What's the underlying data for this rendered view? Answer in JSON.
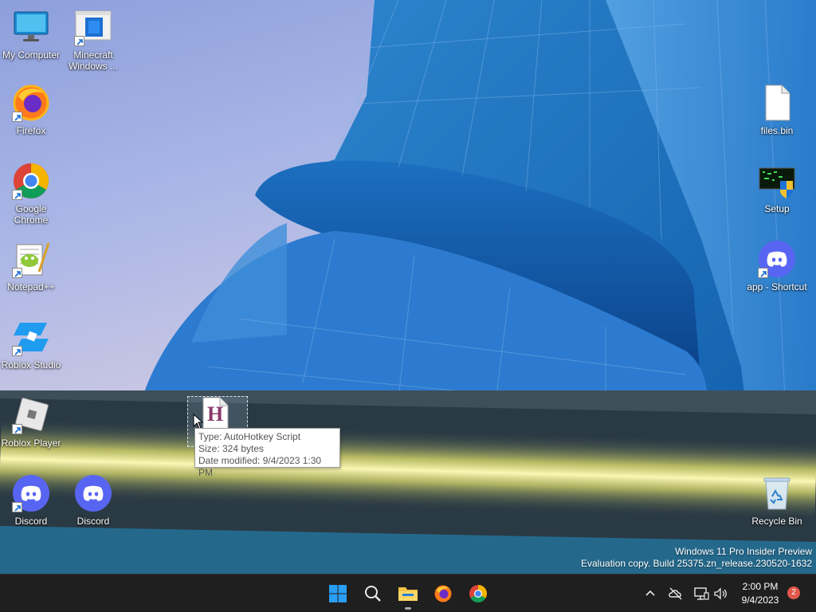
{
  "desktop": {
    "icons_left": [
      {
        "label": "My Computer",
        "icon": "monitor-icon",
        "shortcut": false
      },
      {
        "label": "Minecraft Windows ...",
        "icon": "minecraft-launcher-icon",
        "shortcut": true
      },
      {
        "label": "Firefox",
        "icon": "firefox-icon",
        "shortcut": true
      },
      {
        "label": "Google Chrome",
        "icon": "chrome-icon",
        "shortcut": true
      },
      {
        "label": "Notepad++",
        "icon": "notepadpp-icon",
        "shortcut": true
      },
      {
        "label": "Roblox Studio",
        "icon": "roblox-studio-icon",
        "shortcut": true
      },
      {
        "label": "Roblox Player",
        "icon": "roblox-player-icon",
        "shortcut": true
      },
      {
        "label": "Discord",
        "icon": "discord-icon",
        "shortcut": true
      },
      {
        "label": "Discord",
        "icon": "discord-icon",
        "shortcut": false
      }
    ],
    "icons_right": [
      {
        "label": "files.bin",
        "icon": "blank-file-icon",
        "shortcut": false
      },
      {
        "label": "Setup",
        "icon": "setup-installer-icon",
        "shortcut": false
      },
      {
        "label": "app - Shortcut",
        "icon": "discord-icon",
        "shortcut": true
      },
      {
        "label": "Recycle Bin",
        "icon": "recycle-bin-icon",
        "shortcut": false
      }
    ],
    "dragged_file": {
      "icon": "autohotkey-script-icon",
      "glyph": "H"
    },
    "tooltip": {
      "type": "Type: AutoHotkey Script",
      "size": "Size: 324 bytes",
      "modified": "Date modified: 9/4/2023 1:30 PM"
    },
    "watermark": {
      "line1": "Windows 11 Pro Insider Preview",
      "line2": "Evaluation copy. Build 25375.zn_release.230520-1632"
    }
  },
  "taskbar": {
    "apps": [
      {
        "name": "start-button",
        "icon": "windows-logo-icon"
      },
      {
        "name": "search-button",
        "icon": "search-icon"
      },
      {
        "name": "file-explorer-button",
        "icon": "folder-icon",
        "active": true
      },
      {
        "name": "firefox-button",
        "icon": "firefox-icon"
      },
      {
        "name": "chrome-button",
        "icon": "chrome-icon"
      }
    ],
    "tray": {
      "icons": [
        "chevron-up-icon",
        "onedrive-offline-icon",
        "network-icon",
        "volume-icon"
      ],
      "time": "2:00 PM",
      "date": "9/4/2023",
      "notifications": "2"
    }
  },
  "colors": {
    "taskbar_bg": "#1f1f1f",
    "windows_blue": "#1f8fe5",
    "discord_blurple": "#5865f2",
    "notification_red": "#e0584a"
  }
}
